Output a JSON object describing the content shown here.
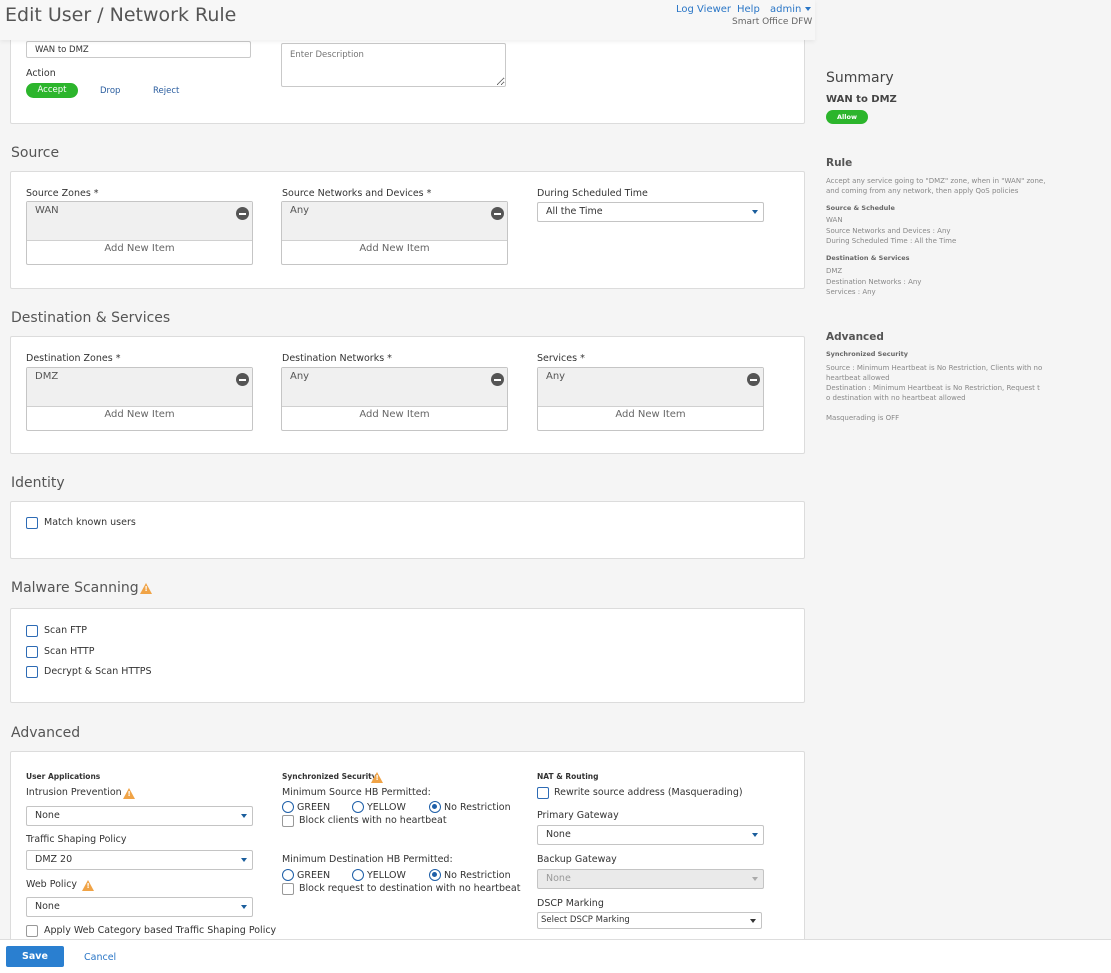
{
  "header": {
    "title": "Edit User / Network Rule",
    "log_viewer": "Log Viewer",
    "help": "Help",
    "user": "admin",
    "device": "Smart Office DFW"
  },
  "rule": {
    "name": "WAN to DMZ",
    "description_placeholder": "Enter Description",
    "action_label": "Action",
    "actions": [
      "Accept",
      "Drop",
      "Reject"
    ]
  },
  "source": {
    "title": "Source",
    "zones_label": "Source Zones *",
    "zones_value": "WAN",
    "networks_label": "Source Networks and Devices *",
    "networks_value": "Any",
    "schedule_label": "During Scheduled Time",
    "schedule_value": "All the Time",
    "add_item": "Add New Item"
  },
  "destination": {
    "title": "Destination & Services",
    "zones_label": "Destination Zones *",
    "zones_value": "DMZ",
    "networks_label": "Destination Networks *",
    "networks_value": "Any",
    "services_label": "Services *",
    "services_value": "Any",
    "add_item": "Add New Item"
  },
  "identity": {
    "title": "Identity",
    "match_users": "Match known users"
  },
  "malware": {
    "title": "Malware Scanning",
    "scan_ftp": "Scan FTP",
    "scan_http": "Scan HTTP",
    "decrypt_https": "Decrypt & Scan HTTPS"
  },
  "advanced": {
    "title": "Advanced",
    "user_apps": "User Applications",
    "ips_label": "Intrusion Prevention",
    "ips_value": "None",
    "tsp_label": "Traffic Shaping Policy",
    "tsp_value": "DMZ 20",
    "web_label": "Web Policy",
    "web_value": "None",
    "web_cat": "Apply Web Category based Traffic Shaping Policy",
    "sync_sec": "Synchronized Security",
    "min_src_label": "Minimum Source HB Permitted:",
    "min_dst_label": "Minimum Destination HB Permitted:",
    "green": "GREEN",
    "yellow": "YELLOW",
    "no_restriction": "No Restriction",
    "block_clients": "Block clients with no heartbeat",
    "block_request": "Block request to destination with no heartbeat",
    "nat": "NAT & Routing",
    "masq_label": "Rewrite source address (Masquerading)",
    "pg_label": "Primary Gateway",
    "pg_value": "None",
    "bg_label": "Backup Gateway",
    "bg_value": "None",
    "dscp_label": "DSCP Marking",
    "dscp_value": "Select DSCP Marking"
  },
  "summary": {
    "title": "Summary",
    "rule_name": "WAN to DMZ",
    "badge": "Allow",
    "rule_heading": "Rule",
    "rule_line1": "Accept any service going to \"DMZ\" zone, when in \"WAN\" zone,",
    "rule_line2": "and coming from any network, then apply QoS policies",
    "ss_heading": "Source & Schedule",
    "ss_line1": "WAN",
    "ss_line2": "Source Networks and Devices : Any",
    "ss_line3": "During Scheduled Time : All the Time",
    "ds_heading": "Destination & Services",
    "ds_line1": "DMZ",
    "ds_line2": "Destination Networks : Any",
    "ds_line3": "Services : Any",
    "adv_heading": "Advanced",
    "sync_heading": "Synchronized Security",
    "sync_line1": "Source : Minimum Heartbeat is No Restriction, Clients with no",
    "sync_line2": "heartbeat allowed",
    "sync_line3": "Destination : Minimum Heartbeat is No Restriction, Request t",
    "sync_line4": "o destination with no heartbeat allowed",
    "masq": "Masquerading is OFF"
  },
  "footer": {
    "save": "Save",
    "cancel": "Cancel"
  }
}
